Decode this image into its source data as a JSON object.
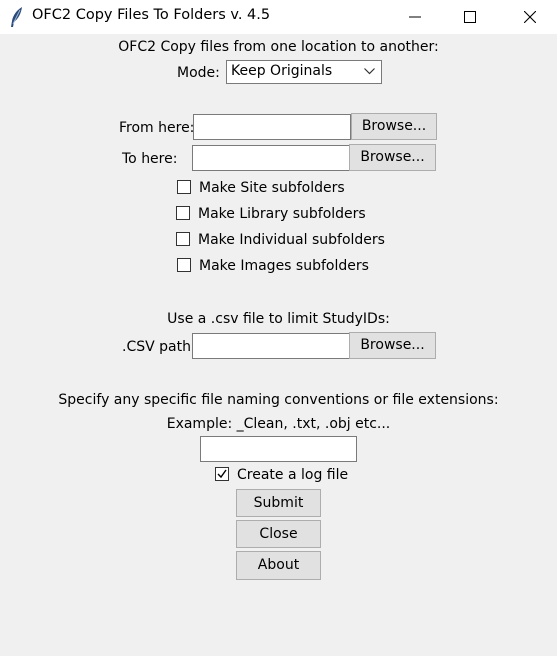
{
  "window": {
    "title": "OFC2 Copy Files To Folders v. 4.5",
    "controls": [
      "minimize",
      "maximize",
      "close"
    ]
  },
  "header": {
    "heading": "OFC2 Copy files from one location to another:",
    "mode_label": "Mode:",
    "mode_value": "Keep Originals"
  },
  "paths": {
    "from_label": "From here:",
    "from_value": "",
    "to_label": "To here:",
    "to_value": "",
    "browse_label": "Browse..."
  },
  "options": [
    {
      "label": "Make Site subfolders",
      "checked": false
    },
    {
      "label": "Make Library subfolders",
      "checked": false
    },
    {
      "label": "Make Individual subfolders",
      "checked": false
    },
    {
      "label": "Make Images subfolders",
      "checked": false
    }
  ],
  "csv": {
    "heading": "Use a .csv file to limit StudyIDs:",
    "path_label": ".CSV path:",
    "path_value": "",
    "browse_label": "Browse..."
  },
  "naming": {
    "heading": "Specify any specific file naming conventions or file extensions:",
    "example": "Example: _Clean, .txt, .obj etc...",
    "value": ""
  },
  "log": {
    "label": "Create a log file",
    "checked": true
  },
  "actions": {
    "submit_label": "Submit",
    "close_label": "Close",
    "about_label": "About"
  }
}
